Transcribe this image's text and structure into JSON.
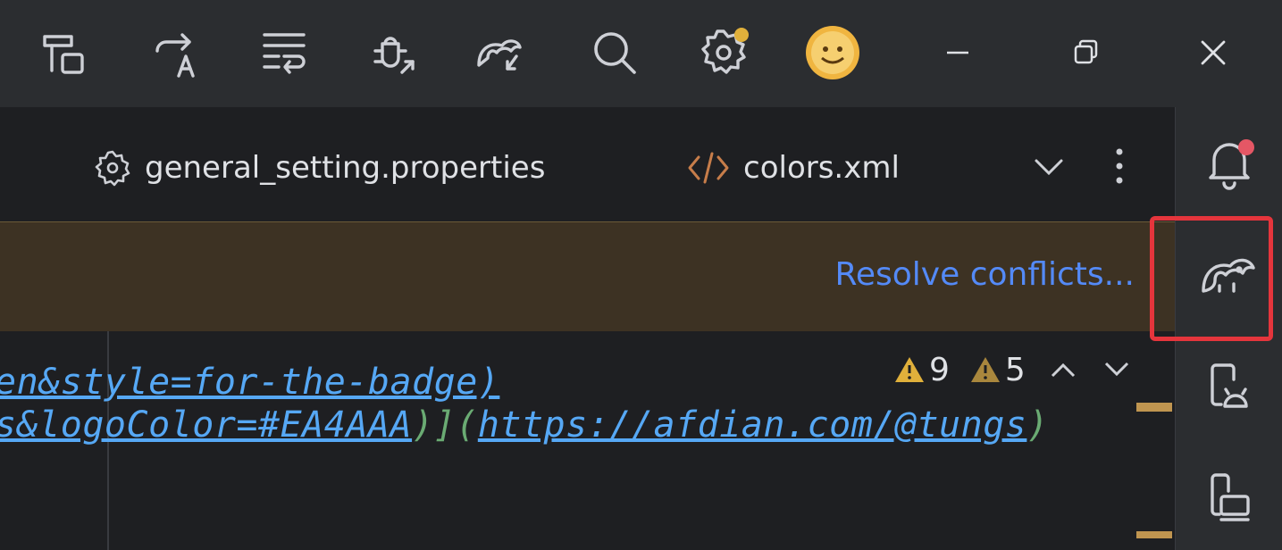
{
  "titlebar": {
    "icons": [
      "build-hammer-icon",
      "translate-icon",
      "wrap-lines-icon",
      "debug-attach-icon",
      "gradle-sync-icon",
      "search-icon",
      "settings-icon",
      "avatar"
    ],
    "window_controls": [
      "minimize-icon",
      "restore-icon",
      "close-icon"
    ]
  },
  "tabs": [
    {
      "label": "general_setting.properties",
      "icon": "gear-icon"
    },
    {
      "label": "colors.xml",
      "icon": "xml-code-icon"
    }
  ],
  "banner": {
    "action_label": "Resolve conflicts..."
  },
  "editor": {
    "line1": "en&style=for-the-badge)",
    "line2_blue": "s&logoColor=#EA4AAA",
    "line2_mid": ")](",
    "line2_link": "https://afdian.com/@tungs",
    "line2_end": ")",
    "warnings": {
      "errors_count": "9",
      "warnings_count": "5"
    }
  },
  "right_strip": [
    "notifications-icon",
    "gradle-icon",
    "device-manager-icon",
    "running-devices-icon"
  ],
  "colors": {
    "accent": "#548af7",
    "banner_bg": "#3d3223",
    "highlight": "#e5353c",
    "warning": "#e0b03b"
  }
}
